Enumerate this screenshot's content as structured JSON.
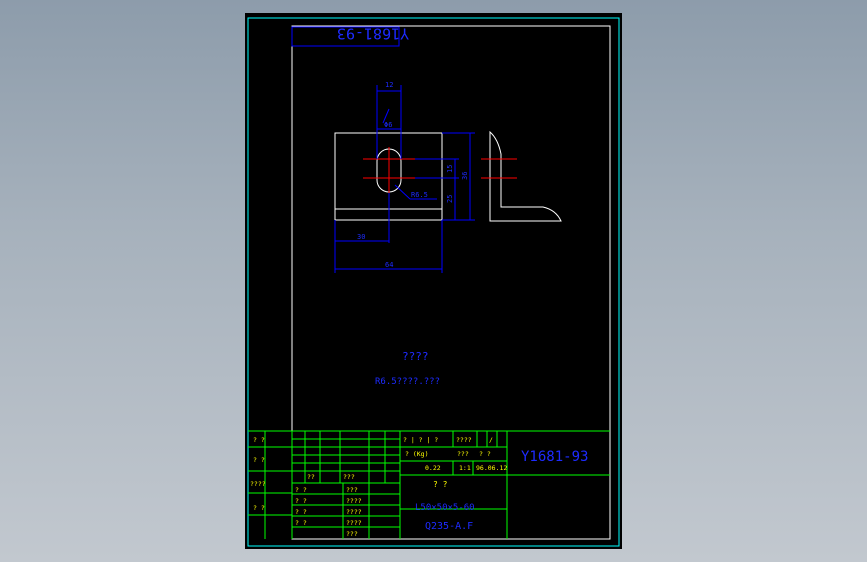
{
  "drawing": {
    "code_box": "Y1681-93",
    "title_code": "Y1681-93",
    "dims": {
      "top_width": "12",
      "slot_width": "Φ6",
      "height_right": "36",
      "height_right2": "25",
      "height_right3": "15",
      "radius": "R6.5",
      "left_bottom": "30",
      "total_width": "64"
    },
    "note_title": "????",
    "note_body": "R6.5????.???"
  },
  "title_block": {
    "header_labels": [
      "? | ? | ?",
      "????",
      "/"
    ],
    "weight_label": "? (Kg)",
    "weight_value": "???",
    "qty_label": "? ?",
    "scale": "0.22",
    "number": "1:1",
    "date": "96.06.12",
    "part_name": "? ?",
    "spec": "L50×50×5-60",
    "material": "Q235-A.F"
  },
  "revision_block": {
    "left_labels": [
      "? ?",
      "? ?",
      "????",
      "? ?"
    ],
    "row_labels": [
      "? ?",
      "? ?",
      "? ?",
      "? ?"
    ],
    "mid_labels": [
      "???",
      "????",
      "????",
      "????",
      "???"
    ],
    "small": [
      "??",
      "???"
    ]
  },
  "colors": {
    "frame": "#00ffff",
    "border": "#ffffff",
    "dimension": "#0000ff",
    "text_blue": "#1d2bff",
    "centerline": "#ff0000",
    "table_line": "#00ff00",
    "table_text": "#ffff00",
    "background": "#000000"
  }
}
